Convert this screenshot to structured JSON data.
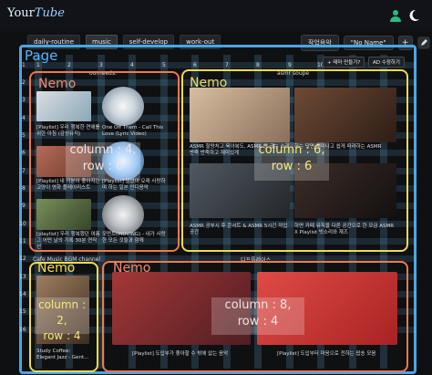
{
  "app": {
    "logo_main": "Your",
    "logo_accent": "Tube"
  },
  "header_icons": [
    "person-icon",
    "moon-icon"
  ],
  "tabs": [
    {
      "label": "daily-routine",
      "active": false
    },
    {
      "label": "music",
      "active": true
    },
    {
      "label": "self-develop",
      "active": false
    },
    {
      "label": "work-out",
      "active": false
    }
  ],
  "controls": {
    "category": "작업음악",
    "profile": "\"No Name\"",
    "add": "+",
    "edit_icon": "edit-icon"
  },
  "page": {
    "title": "Page"
  },
  "grid": {
    "columns": [
      "1",
      "2",
      "3",
      "4",
      "5",
      "6",
      "7",
      "8",
      "9",
      "10",
      "11",
      "12"
    ],
    "rows": [
      "1",
      "2",
      "3",
      "4",
      "5",
      "6",
      "7",
      "8",
      "9",
      "10",
      "11",
      "12",
      "13",
      "14",
      "15",
      "16"
    ]
  },
  "sections": [
    {
      "channel": "ourneeds.",
      "title": "Nemo",
      "color": "#ef7a4a",
      "overlay": {
        "line1": "column : 4,",
        "line2": "row : 6"
      },
      "items": [
        {
          "caption": "[Playlist] 우리 행복한 연애를 위한 아침 (감성뮤직)"
        },
        {
          "caption": "One Off Them - Call This Love (Lyric Video)"
        },
        {
          "caption": "[Playlist] 내 기분이 좋아지는 고양이 영화 플레이리스트"
        },
        {
          "caption": "[Playlist] 말없이 오래 사랑하며 하는 일본 인디음악"
        },
        {
          "caption": "[playlist] 우리 행복했던 여름 그 어떤 날의 기록 30분 연작선"
        },
        {
          "caption": "모먼트(MOVING) - 내가 사랑한 모든 것들과 함께"
        }
      ]
    },
    {
      "channel": "asmr soupe",
      "title": "Nemo",
      "color": "#f0dc4b",
      "overlay": {
        "line1": "column : 6,",
        "line2": "row : 6"
      },
      "buttons": [
        "+ 테마 만들기?",
        "AD 수정하기"
      ],
      "items": [
        {
          "caption": "ASMR 할량처고 육아복도, ASMR 빵 굽는 소리 반죽 반죽하고 재미있게"
        },
        {
          "caption": "하는 단면 재미나고 쉽게 따라하는 ASMR"
        },
        {
          "caption": "ASMR 공부시 후 콘서트 & ASMR 5시간 작업 공간"
        },
        {
          "caption": "하면 카페 뮤직을 다른 공간으로 한 모금 ASMR X Playlist 빗소리와 재즈"
        }
      ]
    },
    {
      "channel": "Cafe Music BGM channel",
      "title": "Nemo",
      "color": "#f0dc4b",
      "overlay": {
        "line1": "column : 2,",
        "line2": "row : 4"
      },
      "items": [
        {
          "caption": "Study Coffee: Elegant Jazz - Gent..."
        }
      ]
    },
    {
      "channel": "디프플레이스",
      "title": "Nemo",
      "color": "#ef7a4a",
      "overlay": {
        "line1": "column : 8,",
        "line2": "row : 4"
      },
      "items": [
        {
          "caption": "[Playlist] 도입부가 좋아할 수 밖에 없는 음악"
        },
        {
          "caption": "[Playlist] 도입부터 마음으로 전하는 팝송 모음"
        }
      ]
    }
  ],
  "colors": {
    "frame": "#4aa6e6",
    "accent_blue": "#57b4ff",
    "orange": "#ef7a4a",
    "yellow": "#f0dc4b"
  }
}
